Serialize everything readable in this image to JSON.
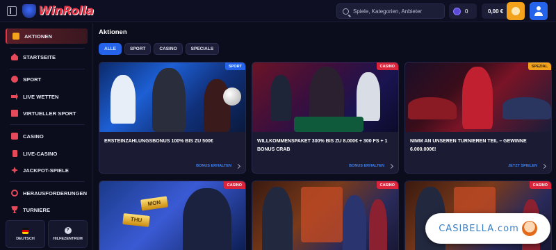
{
  "header": {
    "logo_text": "WinRolla",
    "search_placeholder": "Spiele, Kategorien, Anbieter",
    "points": "0",
    "balance": "0,00 €"
  },
  "sidebar": {
    "items": [
      {
        "label": "Aktionen",
        "icon": "gift-icon",
        "active": true
      },
      {
        "label": "Startseite",
        "icon": "home-icon"
      },
      {
        "label": "Sport",
        "icon": "ball-icon"
      },
      {
        "label": "Live Wetten",
        "icon": "live-icon"
      },
      {
        "label": "Virtueller Sport",
        "icon": "screen-icon"
      },
      {
        "label": "Casino",
        "icon": "casino-icon"
      },
      {
        "label": "Live-Casino",
        "icon": "phone-icon"
      },
      {
        "label": "Jackpot-Spiele",
        "icon": "clover-icon"
      },
      {
        "label": "Herausforderungen",
        "icon": "target-icon"
      },
      {
        "label": "Turniere",
        "icon": "trophy-icon"
      }
    ],
    "bottom": {
      "language": "Deutsch",
      "help": "Hilfezentrum"
    }
  },
  "main": {
    "title": "Aktionen",
    "filters": [
      "Alle",
      "Sport",
      "Casino",
      "Specials"
    ],
    "cards": [
      {
        "tag": "Sport",
        "title": "Ersteinzahlungsbonus 100% bis zu 500€",
        "link": "Bonus erhalten"
      },
      {
        "tag": "Casino",
        "title": "Willkommenspaket 300% bis zu 8.000€ + 300 FS + 1 Bonus Crab",
        "link": "Bonus erhalten"
      },
      {
        "tag": "Spezial",
        "title": "Nimm an unseren Turnieren teil – Gewinne 6.000.000€!",
        "link": "Jetzt spielen"
      },
      {
        "tag": "Casino",
        "gold_bars": [
          "MON",
          "THU"
        ]
      },
      {
        "tag": "Casino"
      },
      {
        "tag": "Casino"
      }
    ]
  },
  "watermark": "CASIBELLA.com",
  "colors": {
    "accent_red": "#e63446",
    "accent_blue": "#2563eb",
    "accent_gold": "#f3a31b",
    "background": "#0c0d1c"
  }
}
